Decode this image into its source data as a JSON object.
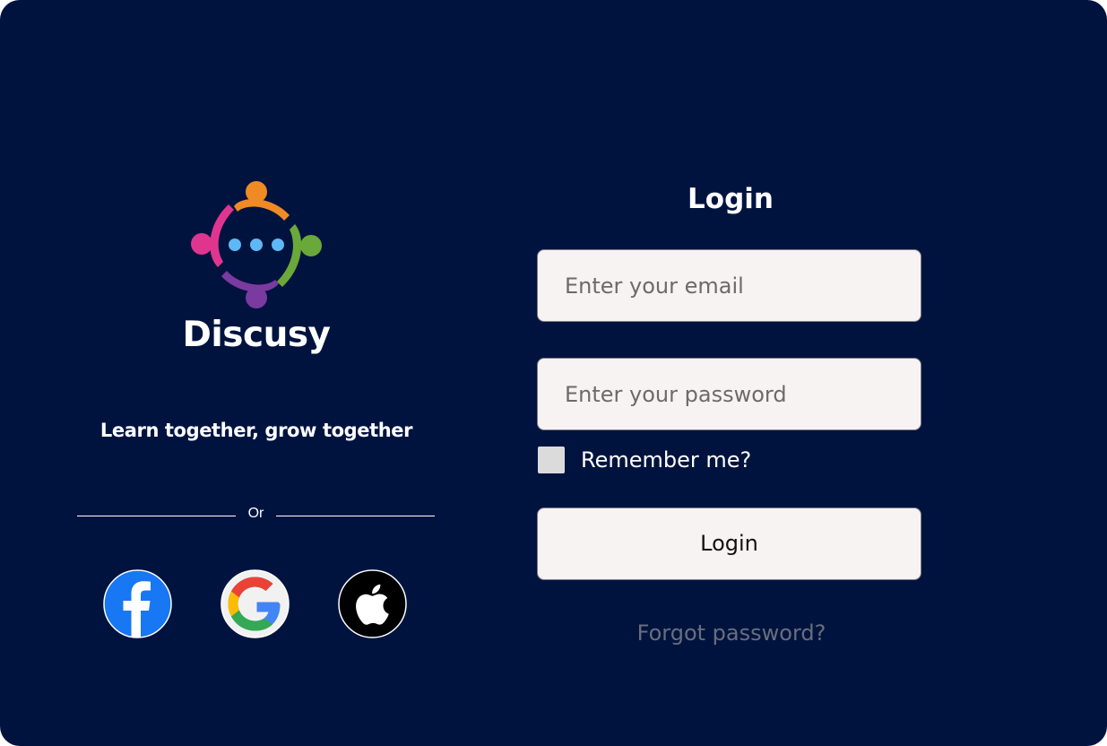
{
  "brand": {
    "name": "Discusy",
    "tagline": "Learn together, grow together"
  },
  "divider": {
    "label": "Or"
  },
  "social": {
    "facebook_icon": "facebook-icon",
    "google_icon": "google-icon",
    "apple_icon": "apple-icon"
  },
  "login": {
    "title": "Login",
    "email_placeholder": "Enter your email",
    "password_placeholder": "Enter your password",
    "remember_label": "Remember me?",
    "button_label": "Login",
    "forgot_label": "Forgot password?"
  },
  "colors": {
    "background": "#00133f",
    "field": "#f7f3f2",
    "muted_link": "#6a6e7c",
    "logo_orange": "#f08a24",
    "logo_green": "#6aa83a",
    "logo_purple": "#7b3aa0",
    "logo_pink": "#e0358f",
    "logo_dots": "#5eb8f5"
  }
}
